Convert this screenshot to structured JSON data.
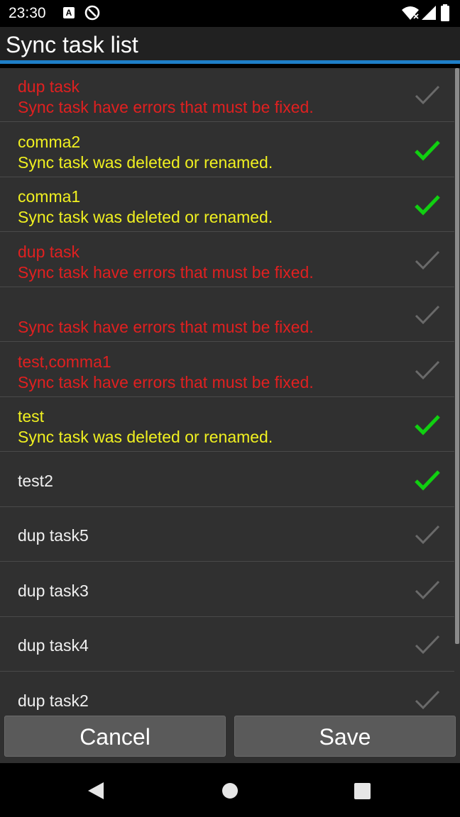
{
  "status_bar": {
    "time": "23:30",
    "a_badge": "A",
    "icons": [
      "a-badge-icon",
      "at-sign-icon",
      "wifi-icon",
      "signal-icon",
      "battery-icon"
    ]
  },
  "header": {
    "title": "Sync task list"
  },
  "colors": {
    "error": "#e02020",
    "warning": "#f0f020",
    "normal": "#f0f0f0",
    "checked": "#10d010",
    "unchecked": "#6a6a6a",
    "accent": "#1e7fc8"
  },
  "task_list": {
    "items": [
      {
        "name": "dup task",
        "status": "Sync task have errors that must be fixed.",
        "state": "error",
        "checked": false
      },
      {
        "name": "comma2",
        "status": "Sync task was deleted or renamed.",
        "state": "warning",
        "checked": true
      },
      {
        "name": "comma1",
        "status": "Sync task was deleted or renamed.",
        "state": "warning",
        "checked": true
      },
      {
        "name": "dup task",
        "status": "Sync task have errors that must be fixed.",
        "state": "error",
        "checked": false
      },
      {
        "name": "",
        "status": "Sync task have errors that must be fixed.",
        "state": "error",
        "checked": false
      },
      {
        "name": "test,comma1",
        "status": "Sync task have errors that must be fixed.",
        "state": "error",
        "checked": false
      },
      {
        "name": "test",
        "status": "Sync task was deleted or renamed.",
        "state": "warning",
        "checked": true
      },
      {
        "name": "test2",
        "status": "",
        "state": "normal",
        "checked": true
      },
      {
        "name": "dup task5",
        "status": "",
        "state": "normal",
        "checked": false
      },
      {
        "name": "dup task3",
        "status": "",
        "state": "normal",
        "checked": false
      },
      {
        "name": "dup task4",
        "status": "",
        "state": "normal",
        "checked": false
      },
      {
        "name": "dup task2",
        "status": "",
        "state": "normal",
        "checked": false
      }
    ]
  },
  "buttons": {
    "cancel_label": "Cancel",
    "save_label": "Save"
  },
  "nav_bar": {
    "icons": [
      "back-icon",
      "home-icon",
      "recents-icon"
    ]
  }
}
